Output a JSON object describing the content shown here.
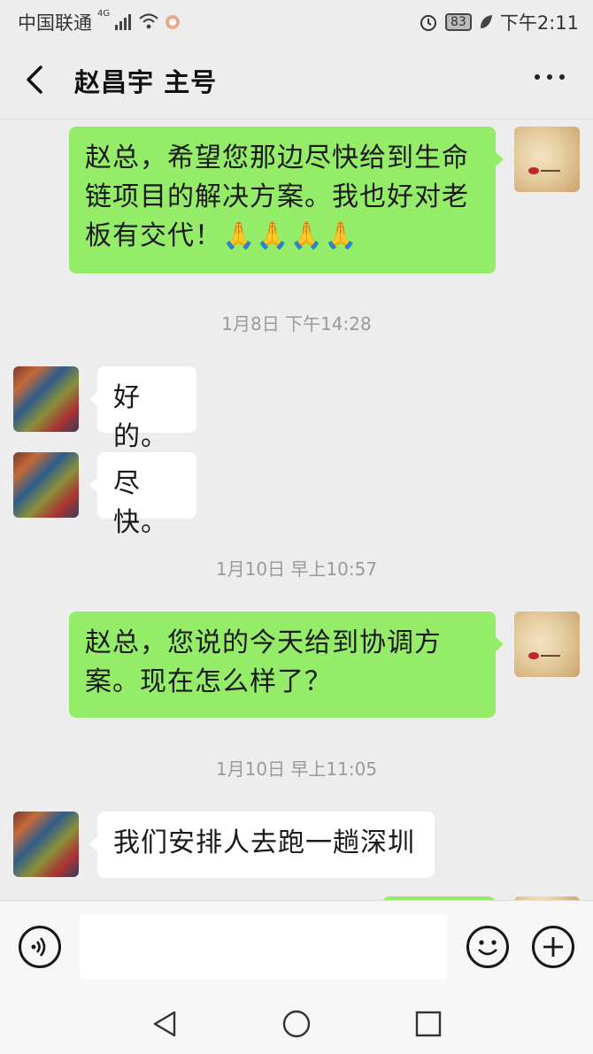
{
  "status_bar": {
    "carrier": "中国联通",
    "network": "4G",
    "battery": "83",
    "time": "下午2:11"
  },
  "header": {
    "title": "赵昌宇 主号"
  },
  "messages": [
    {
      "type": "sent",
      "text": "赵总，希望您那边尽快给到生命链项目的解决方案。我也好对老板有交代！🙏🙏🙏🙏"
    },
    {
      "type": "time",
      "text": "1月8日 下午14:28"
    },
    {
      "type": "recv",
      "text": "好的。"
    },
    {
      "type": "recv",
      "text": "尽快。"
    },
    {
      "type": "time",
      "text": "1月10日 早上10:57"
    },
    {
      "type": "sent",
      "text": "赵总，您说的今天给到协调方案。现在怎么样了？"
    },
    {
      "type": "time",
      "text": "1月10日 早上11:05"
    },
    {
      "type": "recv",
      "text": "我们安排人去跑一趟深圳"
    }
  ],
  "input": {
    "value": ""
  }
}
